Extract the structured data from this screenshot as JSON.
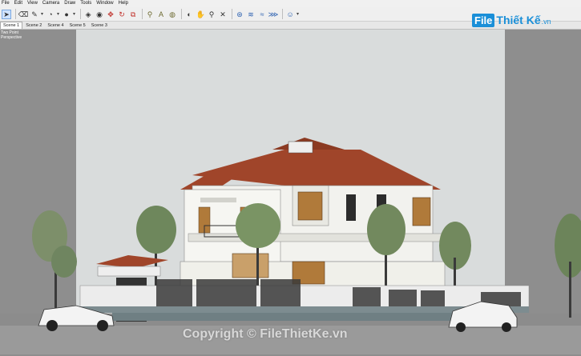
{
  "menu": [
    "File",
    "Edit",
    "View",
    "Camera",
    "Draw",
    "Tools",
    "Window",
    "Help"
  ],
  "toolbar": {
    "tools": [
      {
        "icon": "select-arrow-icon",
        "glyph": "➤",
        "selected": true
      },
      {
        "icon": "eraser-icon",
        "glyph": "⌫"
      },
      {
        "icon": "line-pencil-icon",
        "glyph": "✎",
        "caret": true
      },
      {
        "icon": "arc-icon",
        "glyph": "◔",
        "caret": true
      },
      {
        "icon": "shape-circle-icon",
        "glyph": "●",
        "caret": true
      },
      {
        "icon": "push-pull-icon",
        "glyph": "◈"
      },
      {
        "icon": "offset-icon",
        "glyph": "◉"
      },
      {
        "icon": "move-icon",
        "glyph": "✥"
      },
      {
        "icon": "rotate-icon",
        "glyph": "↻"
      },
      {
        "icon": "scale-icon",
        "glyph": "⧉"
      },
      {
        "icon": "tape-measure-icon",
        "glyph": "⚲"
      },
      {
        "icon": "text-icon",
        "glyph": "A"
      },
      {
        "icon": "paint-bucket-icon",
        "glyph": "◍"
      },
      {
        "icon": "orbit-icon",
        "glyph": "◐"
      },
      {
        "icon": "pan-icon",
        "glyph": "✋"
      },
      {
        "icon": "zoom-icon",
        "glyph": "⚲"
      },
      {
        "icon": "zoom-extents-icon",
        "glyph": "✕"
      },
      {
        "icon": "warehouse-icon",
        "glyph": "⊛"
      },
      {
        "icon": "get-models-icon",
        "glyph": "≋"
      },
      {
        "icon": "share-model-icon",
        "glyph": "≈"
      },
      {
        "icon": "extension-icon",
        "glyph": "⋙"
      },
      {
        "icon": "account-icon",
        "glyph": "☺",
        "caret": true
      }
    ]
  },
  "scenes": [
    "Scene 1",
    "Scene 2",
    "Scene 4",
    "Scene 5",
    "Scene 3"
  ],
  "active_scene": "Scene 1",
  "viewport": {
    "labels": [
      "Two Point",
      "Perspective"
    ]
  },
  "logo": {
    "box": "File",
    "text": "Thiết Kế",
    "suffix": ".vn"
  },
  "watermark": "Copyright © FileThietKe.vn",
  "colors": {
    "roof": "#a0452a",
    "wall": "#f2f2ee",
    "sky": "#d9dcdc",
    "side": "#8e8e8e",
    "accent": "#1a8fd8"
  }
}
